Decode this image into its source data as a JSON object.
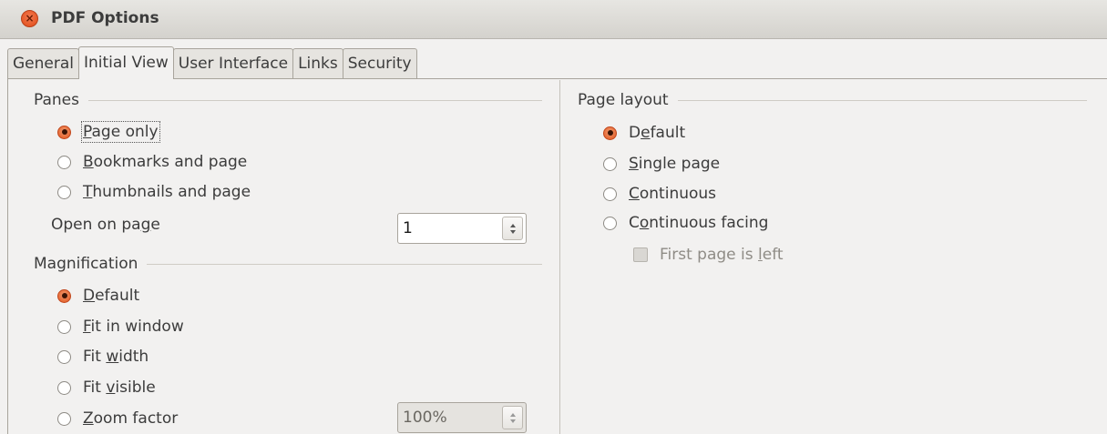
{
  "window": {
    "title": "PDF Options",
    "close_icon": "close-icon",
    "close_glyph": "×"
  },
  "tabs": [
    {
      "label": "General",
      "active": false
    },
    {
      "label": "Initial View",
      "active": true
    },
    {
      "label": "User Interface",
      "active": false
    },
    {
      "label": "Links",
      "active": false
    },
    {
      "label": "Security",
      "active": false
    }
  ],
  "panes": {
    "heading": "Panes",
    "options": [
      {
        "pre": "",
        "key": "P",
        "post": "age only",
        "checked": true
      },
      {
        "pre": "",
        "key": "B",
        "post": "ookmarks and page",
        "checked": false
      },
      {
        "pre": "",
        "key": "T",
        "post": "humbnails and page",
        "checked": false
      }
    ],
    "open_on_page": {
      "pre": "Open on pa",
      "key": "g",
      "post": "e",
      "value": "1"
    }
  },
  "magnification": {
    "heading": "Magnification",
    "options": [
      {
        "pre": "",
        "key": "D",
        "post": "efault",
        "checked": true
      },
      {
        "pre": "",
        "key": "F",
        "post": "it in window",
        "checked": false
      },
      {
        "pre": "Fit ",
        "key": "w",
        "post": "idth",
        "checked": false
      },
      {
        "pre": "Fit ",
        "key": "v",
        "post": "isible",
        "checked": false
      },
      {
        "pre": "",
        "key": "Z",
        "post": "oom factor",
        "checked": false
      }
    ],
    "zoom_value": "100%"
  },
  "page_layout": {
    "heading": "Page layout",
    "options": [
      {
        "pre": "D",
        "key": "e",
        "post": "fault",
        "checked": true
      },
      {
        "pre": "",
        "key": "S",
        "post": "ingle page",
        "checked": false
      },
      {
        "pre": "",
        "key": "C",
        "post": "ontinuous",
        "checked": false
      },
      {
        "pre": "C",
        "key": "o",
        "post": "ntinuous facing",
        "checked": false
      }
    ],
    "first_page_left": {
      "pre": "First page is ",
      "key": "l",
      "post": "eft",
      "checked": false,
      "enabled": false
    }
  },
  "colors": {
    "accent": "#e0561e",
    "window_bg": "#f2f1f0",
    "text": "#3c3c3c"
  }
}
